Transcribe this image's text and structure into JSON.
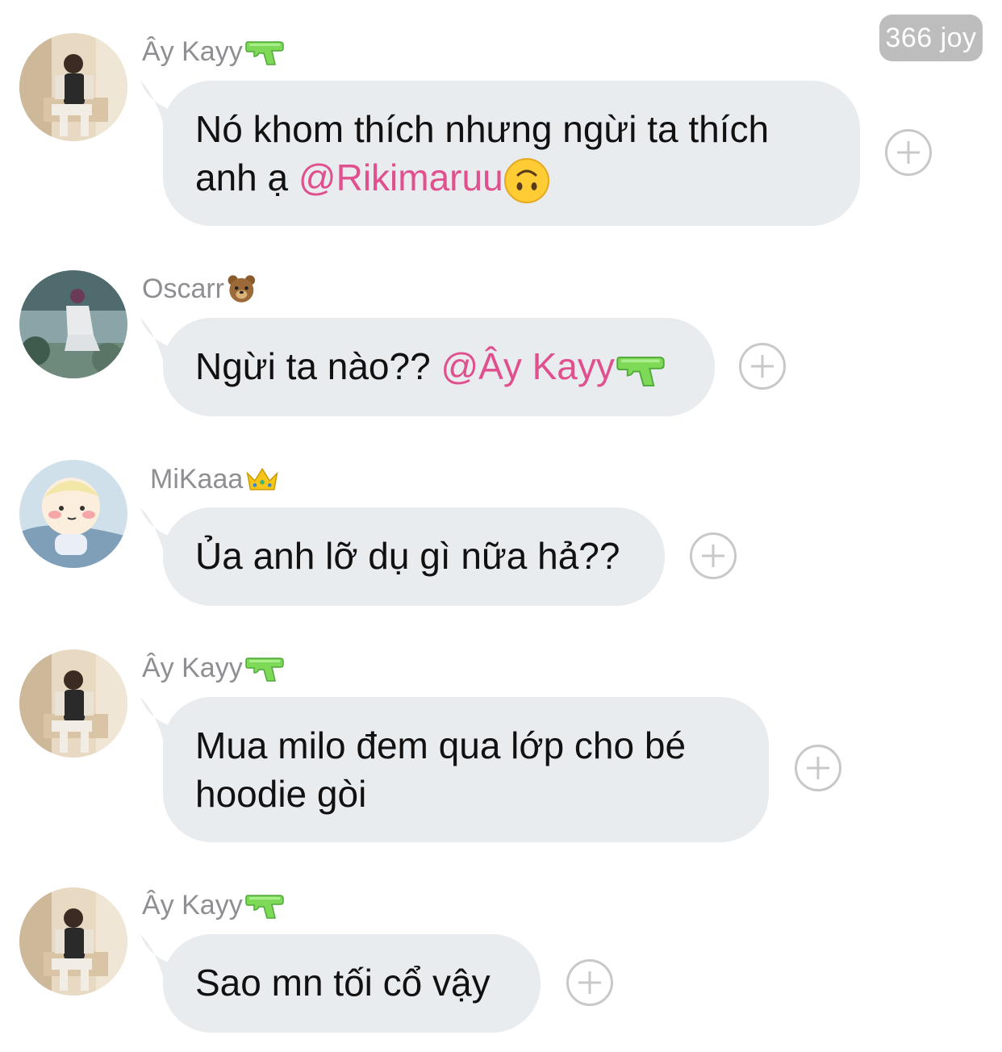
{
  "counter": {
    "label": "366 joy"
  },
  "messages": [
    {
      "sender": "Ây Kayy",
      "sender_icon": "water-pistol-icon",
      "text": "Nó khom thích nhưng ngừi ta thích anh ạ",
      "mention": "@Rikimaruu",
      "trailing_icon": "upside-down-face-icon"
    },
    {
      "sender": "Oscarr",
      "sender_icon": "bear-face-icon",
      "text": "Ngừi ta nào??",
      "mention": "@Ây Kayy",
      "trailing_icon": "water-pistol-icon"
    },
    {
      "sender": "MiKaaa",
      "sender_icon": "crown-icon",
      "text": "Ủa anh lỡ dụ gì nữa hả??"
    },
    {
      "sender": "Ây Kayy",
      "sender_icon": "water-pistol-icon",
      "text": "Mua milo đem qua lớp cho bé hoodie gòi"
    },
    {
      "sender": "Ây Kayy",
      "sender_icon": "water-pistol-icon",
      "text": "Sao mn tối cổ vậy"
    }
  ],
  "colors": {
    "bubble": "#e9ecef",
    "mention": "#e0508e",
    "sender": "#8e8e93",
    "badge": "#bdbdbd"
  }
}
